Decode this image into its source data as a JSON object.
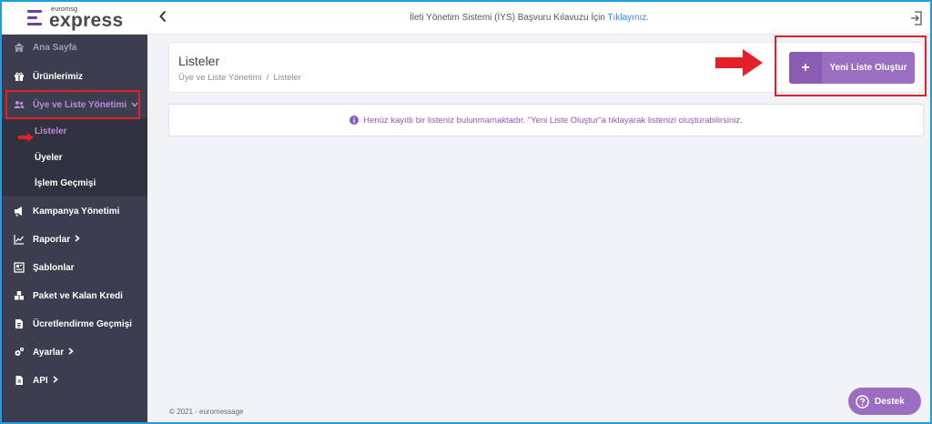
{
  "brand": {
    "tagline": "euromsg",
    "name": "express",
    "color": "#6f3fa0"
  },
  "topbar": {
    "notice_text": "İleti Yönetim Sistemi (İYS) Başvuru Kılavuzu İçin ",
    "notice_link": "Tıklayınız."
  },
  "sidebar": {
    "items": [
      {
        "label": "Ana Sayfa",
        "icon": "home-icon"
      },
      {
        "label": "Ürünlerimiz",
        "icon": "gift-icon"
      },
      {
        "label": "Üye ve Liste Yönetimi",
        "icon": "users-icon"
      },
      {
        "label": "Kampanya Yönetimi",
        "icon": "campaign-icon"
      },
      {
        "label": "Raporlar",
        "icon": "chart-icon"
      },
      {
        "label": "Şablonlar",
        "icon": "template-icon"
      },
      {
        "label": "Paket ve Kalan Kredi",
        "icon": "package-icon"
      },
      {
        "label": "Ücretlendirme Geçmişi",
        "icon": "document-icon"
      },
      {
        "label": "Ayarlar",
        "icon": "gears-icon"
      },
      {
        "label": "API",
        "icon": "file-icon"
      }
    ],
    "subitems": [
      {
        "label": "Listeler"
      },
      {
        "label": "Üyeler"
      },
      {
        "label": "İşlem Geçmişi"
      }
    ],
    "chevron_right": "›",
    "chevron_down": "⌄"
  },
  "main": {
    "title": "Listeler",
    "breadcrumb": [
      "Üye ve Liste Yönetimi",
      "/",
      "Listeler"
    ],
    "new_list_label": "Yeni Liste Oluştur",
    "plus_glyph": "+",
    "empty_message": "Henüz kayıtlı bir listeniz bulunmamaktadır. \"Yeni Liste Oluştur\"a tıklayarak listenizi oluşturabilirsiniz."
  },
  "footer": {
    "copyright": "© 2021 - euromessage"
  },
  "help": {
    "label": "Destek"
  },
  "colors": {
    "accent": "#9b6ec2",
    "sidebar": "#3c3e4f",
    "highlight": "#e2202a"
  }
}
